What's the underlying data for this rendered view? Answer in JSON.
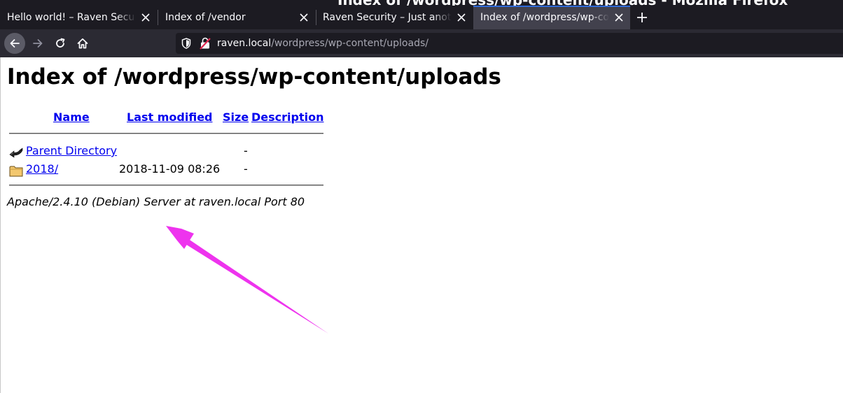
{
  "window": {
    "title": "Index of /wordpress/wp-content/uploads - Mozilla Firefox"
  },
  "tabs": [
    {
      "label": "Hello world! – Raven Security – Just another WordPress site",
      "active": false
    },
    {
      "label": "Index of /vendor",
      "active": false
    },
    {
      "label": "Raven Security – Just another WordPress site",
      "active": false
    },
    {
      "label": "Index of /wordpress/wp-content/uploads",
      "active": true
    }
  ],
  "urlbar": {
    "host": "raven.local",
    "path": "/wordpress/wp-content/uploads/"
  },
  "icons": {
    "back": "arrow-left-icon",
    "forward": "arrow-right-icon",
    "reload": "reload-icon",
    "home": "home-icon",
    "tracking": "shield-icon",
    "insecure": "insecure-lock-icon",
    "close": "close-icon",
    "newtab": "plus-icon"
  },
  "page": {
    "heading": "Index of /wordpress/wp-content/uploads",
    "columns": {
      "name": "Name",
      "last_modified": "Last modified",
      "size": "Size",
      "description": "Description"
    },
    "rows": [
      {
        "icon": "back-arrow-icon",
        "name": "Parent Directory",
        "modified": "",
        "size": "-",
        "description": ""
      },
      {
        "icon": "folder-icon",
        "name": "2018/",
        "modified": "2018-11-09 08:26",
        "size": "-",
        "description": ""
      }
    ],
    "address": "Apache/2.4.10 (Debian) Server at raven.local Port 80"
  },
  "colors": {
    "annotation_arrow": "#ee33ee",
    "link": "#0000ee",
    "tab_active_accent": "#2f6ad9"
  }
}
